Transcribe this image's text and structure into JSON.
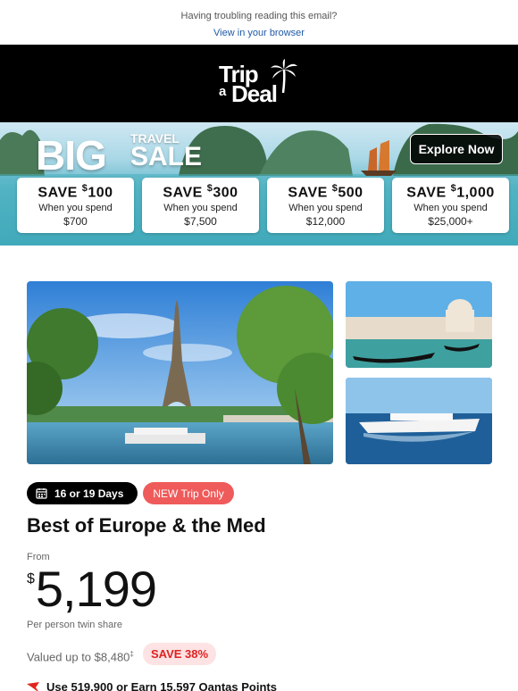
{
  "preheader": {
    "trouble_text": "Having troubling reading this email?",
    "browser_link": "View in your browser"
  },
  "brand": {
    "logo_line1": "Trip",
    "logo_line2a": "a",
    "logo_line2b": "Deal",
    "logo_icon": "palm-tree-icon"
  },
  "banner": {
    "big": "BIG",
    "travel": "TRAVEL",
    "sale": "SALE",
    "explore_label": "Explore Now",
    "offers": [
      {
        "amount_prefix": "SAVE ",
        "currency": "$",
        "amount": "100",
        "condition": "When you spend",
        "spend": "$700"
      },
      {
        "amount_prefix": "SAVE ",
        "currency": "$",
        "amount": "300",
        "condition": "When you spend",
        "spend": "$7,500"
      },
      {
        "amount_prefix": "SAVE ",
        "currency": "$",
        "amount": "500",
        "condition": "When you spend",
        "spend": "$12,000"
      },
      {
        "amount_prefix": "SAVE ",
        "currency": "$",
        "amount": "1,000",
        "condition": "When you spend",
        "spend": "$25,000+"
      }
    ]
  },
  "deal": {
    "duration": "16 or 19 Days",
    "duration_icon": "calendar-icon",
    "badge": "NEW Trip Only",
    "title": "Best of Europe & the Med",
    "from_label": "From",
    "currency": "$",
    "price": "5,199",
    "per_person": "Per person twin share",
    "valued_text": "Valued up to $8,480",
    "valued_mark": "‡",
    "save_badge": "SAVE 38%",
    "qantas_text": "Use 519,900 or Earn 15,597 Qantas Points",
    "qantas_icon": "qantas-kangaroo-icon",
    "images": [
      "eiffel-tower-photo",
      "venice-gondola-photo",
      "cruise-ship-photo"
    ]
  },
  "colors": {
    "accent_red": "#ef5b5b",
    "link_blue": "#1f5aa6",
    "header_black": "#000000"
  }
}
